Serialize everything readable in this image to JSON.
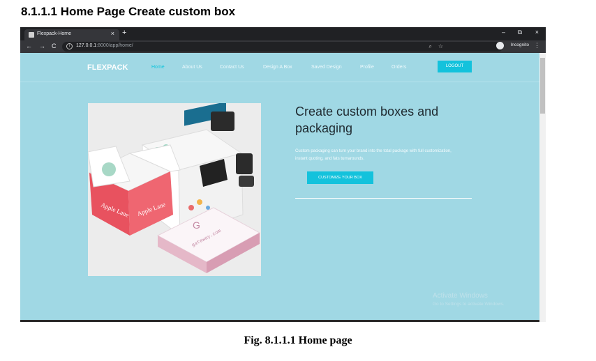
{
  "document": {
    "heading": "8.1.1.1 Home Page Create custom box",
    "caption": "Fig. 8.1.1.1 Home page"
  },
  "browser": {
    "tab_title": "Flexpack-Home",
    "tab_close": "×",
    "new_tab": "+",
    "window_controls": {
      "minimize": "–",
      "restore": "⧉",
      "close": "×"
    },
    "nav": {
      "back": "←",
      "forward": "→",
      "reload": "C"
    },
    "url_host": "127.0.0.1",
    "url_path": ":8000/app/home/",
    "incognito_label": "Incognito",
    "menu": "⋮",
    "zoom": "⌕",
    "star": "☆"
  },
  "site": {
    "brand": "FLEXPACK",
    "nav_items": [
      "Home",
      "About Us",
      "Contact Us",
      "Design A Box",
      "Saved Design",
      "Profile",
      "Orders"
    ],
    "logout": "LOGOUT"
  },
  "hero": {
    "title": "Create custom boxes and packaging",
    "text": "Custom packaging can turn your brand into the total package with full customization, instant quoting, and fats turnarounds.",
    "cta": "CUSTOMIZE YOUR BOX",
    "image_text": {
      "box_brand_1": "Apple Lane",
      "box_brand_2": "Apple Lane",
      "letter": "G",
      "box_side": "gateway.com"
    }
  },
  "watermark": {
    "title": "Activate Windows",
    "subtitle": "Go to Settings to activate Windows."
  },
  "colors": {
    "page_bg": "#a0d8e4",
    "accent": "#13c2dc",
    "chrome_dark": "#202124",
    "chrome_mid": "#35363a"
  }
}
